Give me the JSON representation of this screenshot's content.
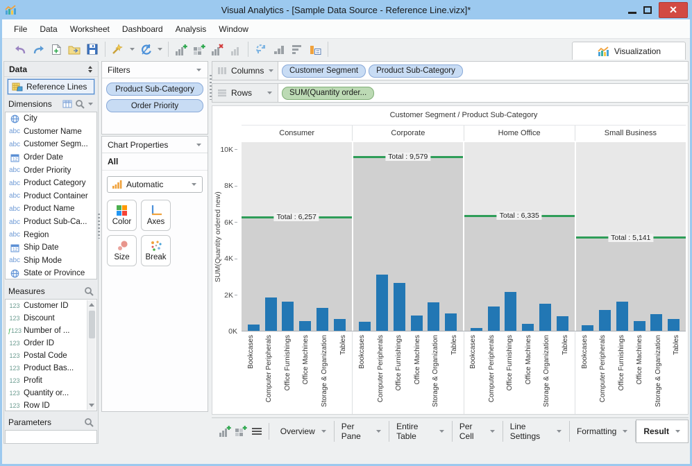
{
  "window": {
    "title": "Visual Analytics - [Sample Data Source - Reference Line.vizx]*"
  },
  "menu": {
    "items": [
      "File",
      "Data",
      "Worksheet",
      "Dashboard",
      "Analysis",
      "Window"
    ]
  },
  "toolbar": {
    "visualization_label": "Visualization",
    "groups": [
      [
        "undo-icon",
        "redo-icon",
        "new-file-icon",
        "open-folder-icon",
        "save-icon"
      ],
      [
        "data-wand-icon",
        "refresh-icon"
      ],
      [
        "add-chart-icon",
        "add-crosstab-icon",
        "remove-chart-icon",
        "chart-disabled-icon"
      ],
      [
        "swap-axes-icon",
        "sort-bars-icon",
        "sort-rows-icon",
        "labels-icon"
      ]
    ],
    "dropdown_icons": [
      "data-wand-icon",
      "refresh-icon"
    ]
  },
  "data_panel": {
    "title": "Data",
    "source": "Reference Lines",
    "dimensions": {
      "label": "Dimensions",
      "items": [
        {
          "icon": "globe-icon",
          "label": "City"
        },
        {
          "icon": "abc-icon",
          "label": "Customer Name"
        },
        {
          "icon": "abc-icon",
          "label": "Customer Segm..."
        },
        {
          "icon": "calendar-icon",
          "label": "Order Date"
        },
        {
          "icon": "abc-icon",
          "label": "Order Priority"
        },
        {
          "icon": "abc-icon",
          "label": "Product Category"
        },
        {
          "icon": "abc-icon",
          "label": "Product Container"
        },
        {
          "icon": "abc-icon",
          "label": "Product Name"
        },
        {
          "icon": "abc-icon",
          "label": "Product Sub-Ca..."
        },
        {
          "icon": "abc-icon",
          "label": "Region"
        },
        {
          "icon": "calendar-icon",
          "label": "Ship Date"
        },
        {
          "icon": "abc-icon",
          "label": "Ship Mode"
        },
        {
          "icon": "globe-icon",
          "label": "State or Province"
        }
      ]
    },
    "measures": {
      "label": "Measures",
      "items": [
        {
          "icon": "num-icon",
          "label": "Customer ID"
        },
        {
          "icon": "num-icon",
          "label": "Discount"
        },
        {
          "icon": "fx-num-icon",
          "label": "Number of ..."
        },
        {
          "icon": "num-icon",
          "label": "Order ID"
        },
        {
          "icon": "num-icon",
          "label": "Postal Code"
        },
        {
          "icon": "num-icon",
          "label": "Product Bas..."
        },
        {
          "icon": "num-icon",
          "label": "Profit"
        },
        {
          "icon": "num-icon",
          "label": "Quantity or..."
        },
        {
          "icon": "num-icon",
          "label": "Row ID"
        }
      ]
    },
    "parameters": {
      "label": "Parameters"
    }
  },
  "filters_panel": {
    "title": "Filters",
    "pills": [
      "Product Sub-Category",
      "Order Priority"
    ]
  },
  "chart_properties": {
    "title": "Chart Properties",
    "scope": "All",
    "mark_type": "Automatic",
    "buttons": [
      {
        "icon": "color-icon",
        "label": "Color"
      },
      {
        "icon": "axes-icon",
        "label": "Axes"
      },
      {
        "icon": "size-icon",
        "label": "Size"
      },
      {
        "icon": "break-icon",
        "label": "Break"
      }
    ]
  },
  "shelves": {
    "columns_label": "Columns",
    "columns_pills": [
      "Customer Segment",
      "Product Sub-Category"
    ],
    "rows_label": "Rows",
    "rows_pills": [
      "SUM(Quantity order..."
    ]
  },
  "chart_data": {
    "type": "bar",
    "title": "Customer Segment / Product Sub-Category",
    "ylabel": "SUM(Quantity ordered new)",
    "yticks": [
      {
        "label": "0K",
        "value": 0
      },
      {
        "label": "2K",
        "value": 2000
      },
      {
        "label": "4K",
        "value": 4000
      },
      {
        "label": "6K",
        "value": 6000
      },
      {
        "label": "8K",
        "value": 8000
      },
      {
        "label": "10K",
        "value": 10000
      }
    ],
    "ylim": [
      0,
      10400
    ],
    "grid": "off",
    "legend": "none",
    "categories": [
      "Bookcases",
      "Computer Peripherals",
      "Office Furnishings",
      "Office Machines",
      "Storage & Organization",
      "Tables"
    ],
    "panes": [
      {
        "segment": "Consumer",
        "values": [
          350,
          1850,
          1600,
          550,
          1250,
          657
        ],
        "reference_line": {
          "label": "Total : 6,257",
          "value": 6257
        }
      },
      {
        "segment": "Corporate",
        "values": [
          480,
          3100,
          2650,
          850,
          1550,
          949
        ],
        "reference_line": {
          "label": "Total : 9,579",
          "value": 9579
        }
      },
      {
        "segment": "Home Office",
        "values": [
          170,
          1330,
          2160,
          390,
          1500,
          785
        ],
        "reference_line": {
          "label": "Total : 6,335",
          "value": 6335
        }
      },
      {
        "segment": "Small Business",
        "values": [
          290,
          1150,
          1620,
          520,
          925,
          636
        ],
        "reference_line": {
          "label": "Total : 5,141",
          "value": 5141
        }
      }
    ],
    "bar_color": "#2277b4",
    "reference_line_color": "#2e9d58"
  },
  "bottom_bar": {
    "icons": [
      "add-sheet-icon",
      "add-dashboard-icon",
      "list-icon"
    ],
    "tabs": [
      "Overview",
      "Per Pane",
      "Entire Table",
      "Per Cell",
      "Line Settings",
      "Formatting",
      "Result"
    ],
    "active_tab": "Result"
  },
  "colors": {
    "titlebar": "#9cc9ef",
    "bar": "#2277b4",
    "reference_line": "#2e9d58",
    "dimension_pill": "#c8dcf4",
    "measure_pill": "#bcdab4",
    "close_button": "#d24a42"
  }
}
